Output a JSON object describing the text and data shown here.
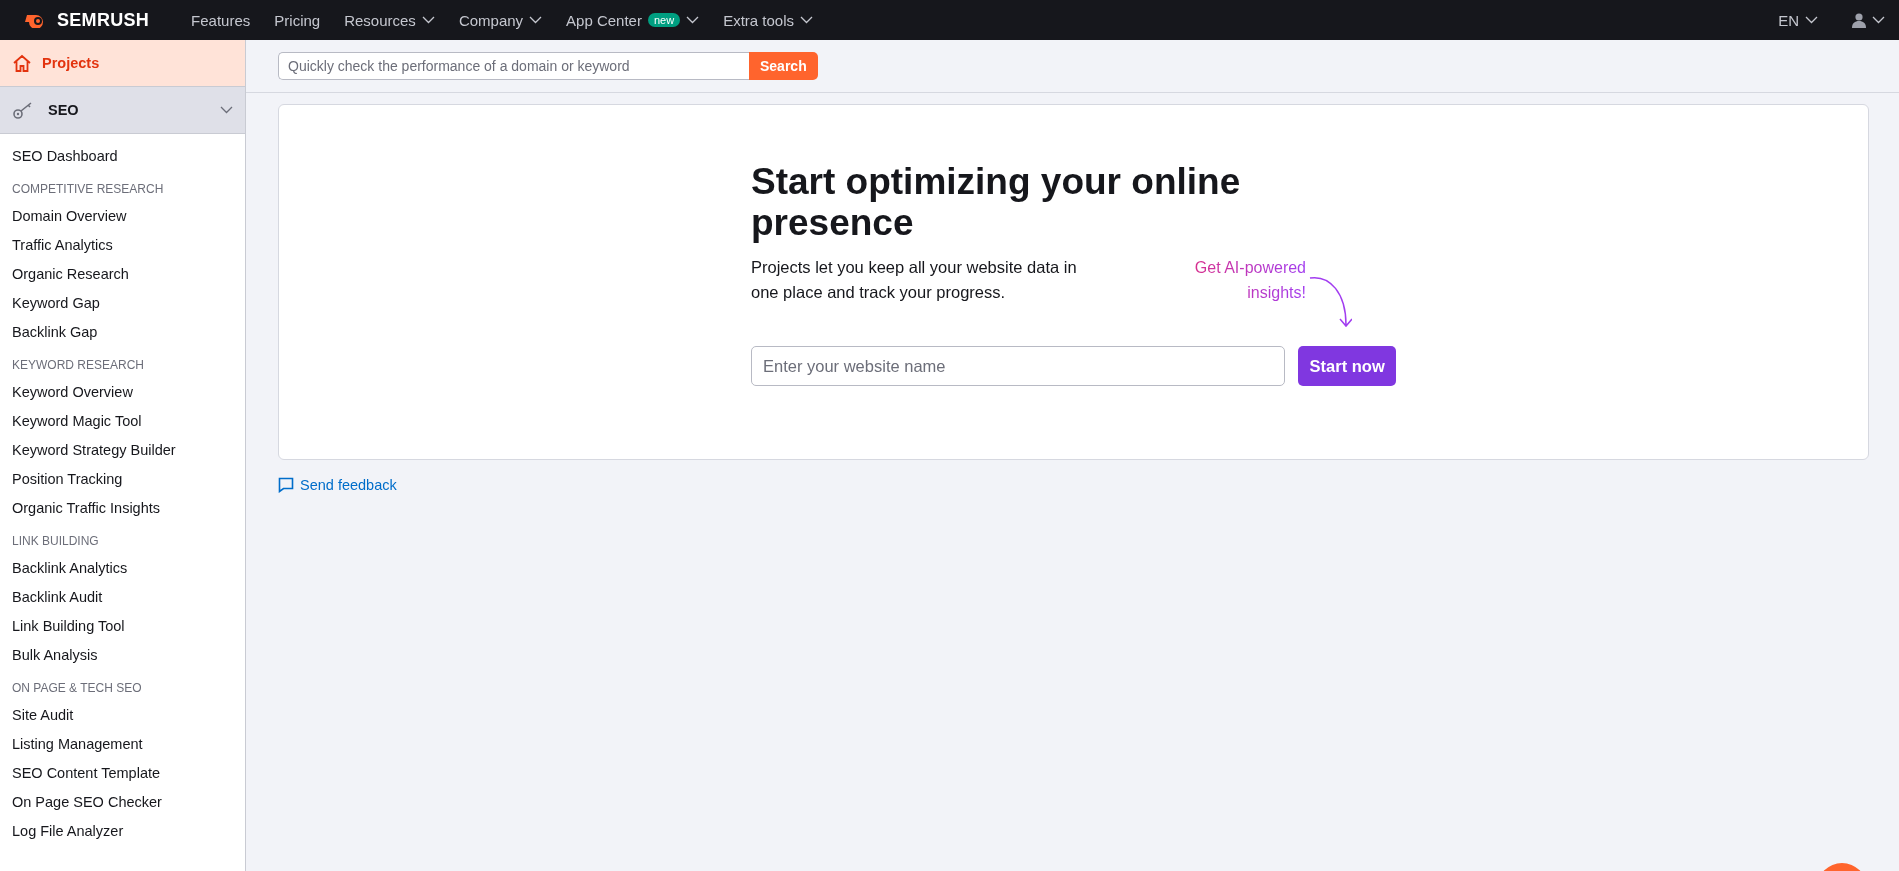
{
  "top_nav": {
    "logo": "SEMRUSH",
    "items": [
      {
        "label": "Features",
        "dropdown": false
      },
      {
        "label": "Pricing",
        "dropdown": false
      },
      {
        "label": "Resources",
        "dropdown": true
      },
      {
        "label": "Company",
        "dropdown": true
      },
      {
        "label": "App Center",
        "badge": "new",
        "dropdown": true
      },
      {
        "label": "Extra tools",
        "dropdown": true
      }
    ],
    "language": "EN"
  },
  "sidebar": {
    "projects": {
      "label": "Projects",
      "selected": true
    },
    "seo": {
      "label": "SEO",
      "expanded": true
    },
    "sections": [
      {
        "items": [
          {
            "label": "SEO Dashboard",
            "selected": false
          }
        ]
      },
      {
        "heading": "COMPETITIVE RESEARCH",
        "items": [
          {
            "label": "Domain Overview",
            "selected": false
          },
          {
            "label": "Traffic Analytics",
            "selected": false
          },
          {
            "label": "Organic Research",
            "selected": false
          },
          {
            "label": "Keyword Gap",
            "selected": false
          },
          {
            "label": "Backlink Gap",
            "selected": false
          }
        ]
      },
      {
        "heading": "KEYWORD RESEARCH",
        "items": [
          {
            "label": "Keyword Overview",
            "selected": false
          },
          {
            "label": "Keyword Magic Tool",
            "selected": false
          },
          {
            "label": "Keyword Strategy Builder",
            "selected": false
          },
          {
            "label": "Position Tracking",
            "selected": false
          },
          {
            "label": "Organic Traffic Insights",
            "selected": false
          }
        ]
      },
      {
        "heading": "LINK BUILDING",
        "items": [
          {
            "label": "Backlink Analytics",
            "selected": false
          },
          {
            "label": "Backlink Audit",
            "selected": false
          },
          {
            "label": "Link Building Tool",
            "selected": false
          },
          {
            "label": "Bulk Analysis",
            "selected": false
          }
        ]
      },
      {
        "heading": "ON PAGE & TECH SEO",
        "items": [
          {
            "label": "Site Audit",
            "selected": false
          },
          {
            "label": "Listing Management",
            "selected": false
          },
          {
            "label": "SEO Content Template",
            "selected": false
          },
          {
            "label": "On Page SEO Checker",
            "selected": false
          },
          {
            "label": "Log File Analyzer",
            "selected": false
          }
        ]
      }
    ]
  },
  "search": {
    "placeholder": "Quickly check the performance of a domain or keyword",
    "button": "Search"
  },
  "card": {
    "heading": "Start optimizing your online presence",
    "description": "Projects let you keep all your website data in one place and track your progress.",
    "promo": [
      "Get AI-powered",
      "insights!"
    ],
    "input_placeholder": "Enter your website name",
    "button": "Start now"
  },
  "feedback": "Send feedback"
}
